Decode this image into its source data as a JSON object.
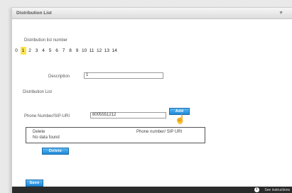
{
  "window": {
    "title": "Distribution List",
    "filter_icon": "filter-icon"
  },
  "list_number": {
    "label": "Distribution list number",
    "numbers": [
      "0",
      "1",
      "2",
      "3",
      "4",
      "5",
      "6",
      "7",
      "8",
      "9",
      "10",
      "11",
      "12",
      "13",
      "14"
    ],
    "selected": "1"
  },
  "description": {
    "label": "Description",
    "value": "1"
  },
  "distribution_list": {
    "label": "Distribution List",
    "phone_label": "Phone Number/SIP-URI",
    "phone_value": "8005551212",
    "add_label": "Add",
    "table": {
      "headers": [
        "Delete",
        "Phone number/ SIP URI"
      ],
      "empty_text": "No data found"
    },
    "delete_label": "Delete"
  },
  "save_label": "Save",
  "footer": {
    "info_icon": "info-icon",
    "instructions_label": "See instructions"
  },
  "colors": {
    "button": "#1f88d6",
    "selected_number": "#ffe44d",
    "footer": "#2a2a2a"
  }
}
